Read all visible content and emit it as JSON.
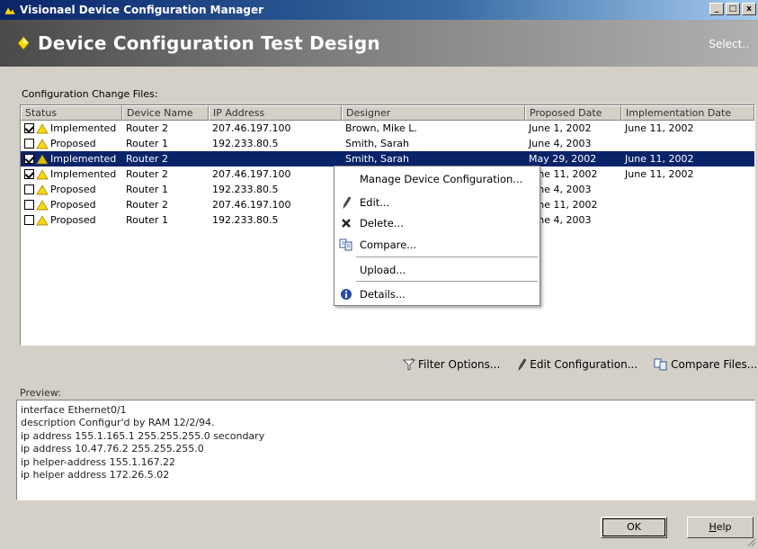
{
  "window": {
    "title": "Visionael Device Configuration Manager",
    "controls": [
      "_",
      "□",
      "x"
    ]
  },
  "header": {
    "title": "Device Configuration Test Design",
    "select_link": "Select.."
  },
  "list": {
    "label": "Configuration Change Files:",
    "columns": [
      "Status",
      "Device Name",
      "IP Address",
      "Designer",
      "Proposed Date",
      "Implementation Date"
    ],
    "rows": [
      {
        "checked": true,
        "status": "Implemented",
        "device": "Router 2",
        "ip": "207.46.197.100",
        "designer": "Brown, Mike L.",
        "proposed": "June 1, 2002",
        "implemented": "June 11, 2002",
        "selected": false
      },
      {
        "checked": false,
        "status": "Proposed",
        "device": "Router 1",
        "ip": "192.233.80.5",
        "designer": "Smith, Sarah",
        "proposed": "June 4, 2003",
        "implemented": "",
        "selected": false
      },
      {
        "checked": true,
        "status": "Implemented",
        "device": "Router 2",
        "ip": "",
        "designer": "Smith, Sarah",
        "proposed": "May 29, 2002",
        "implemented": "June 11, 2002",
        "selected": true
      },
      {
        "checked": true,
        "status": "Implemented",
        "device": "Router 2",
        "ip": "207.46.197.100",
        "designer": "",
        "proposed": "June 11, 2002",
        "implemented": "June 11, 2002",
        "selected": false
      },
      {
        "checked": false,
        "status": "Proposed",
        "device": "Router 1",
        "ip": "192.233.80.5",
        "designer": "",
        "proposed": "June 4, 2003",
        "implemented": "",
        "selected": false
      },
      {
        "checked": false,
        "status": "Proposed",
        "device": "Router 2",
        "ip": "207.46.197.100",
        "designer": "",
        "proposed": "June 11, 2002",
        "implemented": "",
        "selected": false
      },
      {
        "checked": false,
        "status": "Proposed",
        "device": "Router 1",
        "ip": "192.233.80.5",
        "designer": "",
        "proposed": "June 4, 2003",
        "implemented": "",
        "selected": false
      }
    ]
  },
  "context_menu": {
    "items": [
      {
        "label": "Manage Device Configuration...",
        "icon": "none"
      },
      {
        "label": "Edit...",
        "icon": "pencil-icon"
      },
      {
        "label": "Delete...",
        "icon": "delete-x-icon"
      },
      {
        "label": "Compare...",
        "icon": "compare-icon"
      },
      {
        "label": "Upload...",
        "icon": "none"
      },
      {
        "label": "Details...",
        "icon": "info-icon"
      }
    ]
  },
  "toolbar": {
    "filter": "Filter Options...",
    "edit": "Edit Configuration...",
    "compare": "Compare Files..."
  },
  "preview": {
    "label": "Preview:",
    "lines": [
      "interface Ethernet0/1",
      "description Configur'd by RAM 12/2/94.",
      "ip address 155.1.165.1 255.255.255.0 secondary",
      "ip address 10.47.76.2 255.255.255.0",
      "ip helper-address 155.1.167.22",
      "ip helper address 172.26.5.02"
    ]
  },
  "buttons": {
    "ok": "OK",
    "help_pre": "H",
    "help_rest": "elp"
  },
  "colors": {
    "selection": "#0a246a",
    "title_start": "#0a246a",
    "warn": "#ffd800",
    "implemented_warn": "#d8c000"
  }
}
